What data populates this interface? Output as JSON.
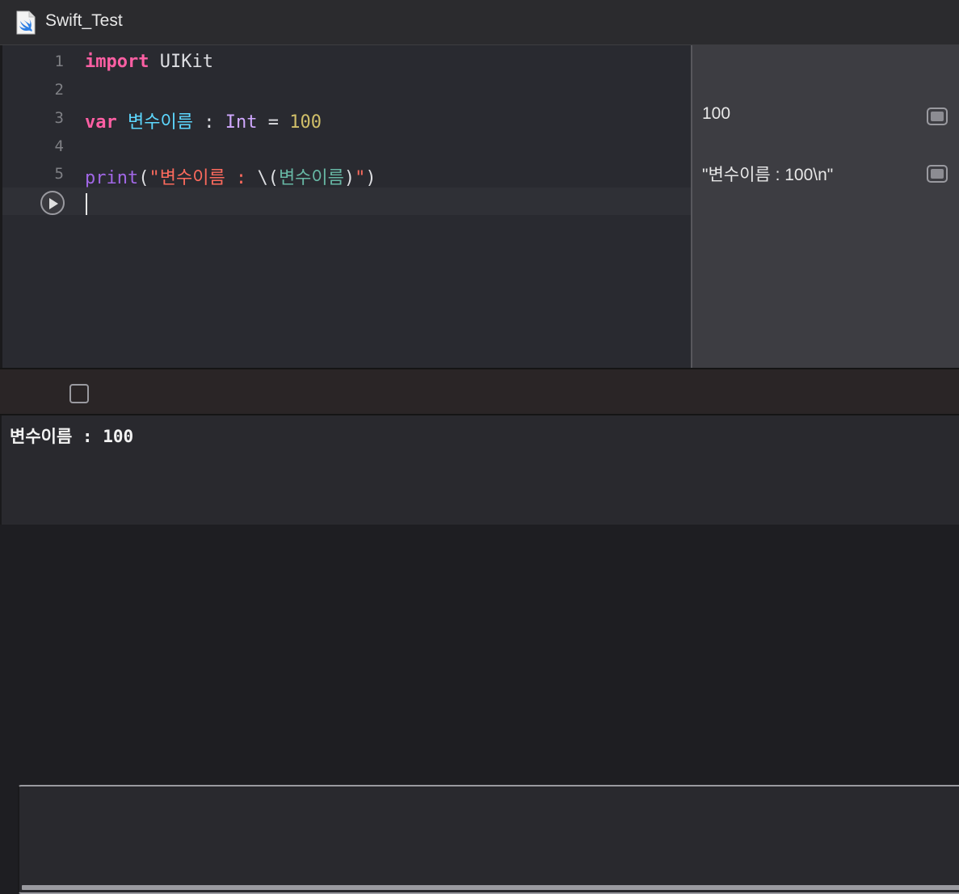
{
  "window": {
    "title": "Swift_Test"
  },
  "editor": {
    "line_numbers": [
      "1",
      "2",
      "3",
      "4",
      "5"
    ],
    "lines": {
      "l1": {
        "kw": "import",
        "name": " UIKit"
      },
      "l3": {
        "kw": "var",
        "var": " 변수이름",
        "colon": " : ",
        "type": "Int",
        "eq": " = ",
        "num": "100"
      },
      "l5": {
        "fn": "print",
        "open": "(",
        "str1": "\"변수이름 : ",
        "interp_open": "\\(",
        "interp_var": "변수이름",
        "interp_close": ")",
        "str2": "\"",
        "close": ")"
      }
    }
  },
  "results": {
    "r3": "100",
    "r5": "\"변수이름 : 100\\n\""
  },
  "console": {
    "output": "변수이름 : 100"
  },
  "colors": {
    "keyword": "#fc5fa3",
    "type": "#d0a8ff",
    "number": "#d0bf69",
    "string": "#fc6a5d",
    "function": "#a167e6"
  }
}
